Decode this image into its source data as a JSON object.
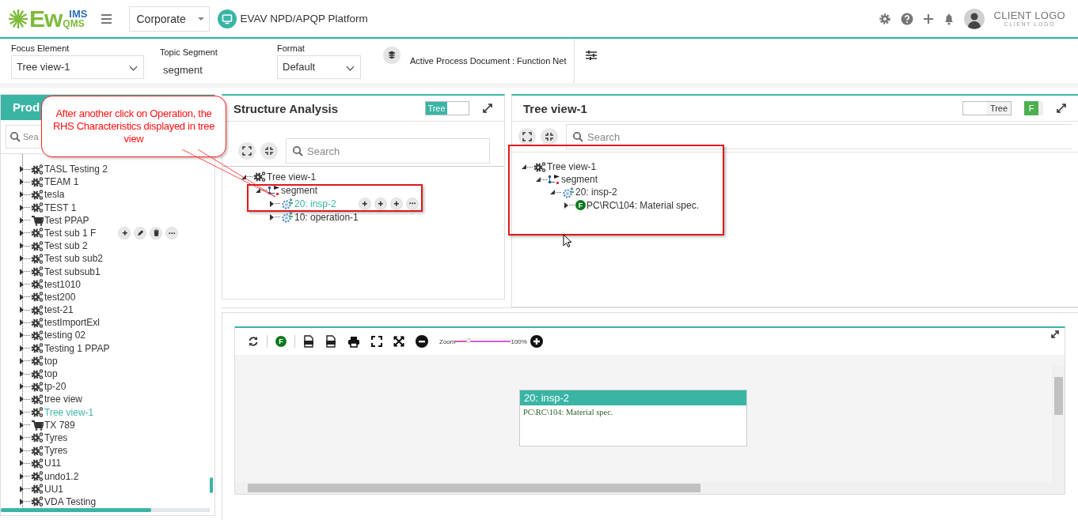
{
  "header": {
    "logo": {
      "main": "Ew",
      "top": "IMS",
      "bottom": "QMS"
    },
    "company": "Corporate",
    "platform": "EVAV NPD/APQP Platform",
    "client_logo": "CLIENT LOGO",
    "client_logo_sub": "CLIENT LOGO"
  },
  "toolbar": {
    "fields": [
      {
        "label": "Focus Element",
        "value": "Tree view-1",
        "kind": "select"
      },
      {
        "label": "Topic Segment",
        "value": "segment",
        "kind": "text"
      },
      {
        "label": "Format",
        "value": "Default",
        "kind": "select"
      }
    ],
    "active_document": "Active Process Document : Function Net"
  },
  "sidebar": {
    "title": "Prod",
    "search_placeholder": "Sea",
    "items": [
      {
        "label": "TASL Testing 2",
        "kind": "gear",
        "selected": false,
        "hovered": false
      },
      {
        "label": "TEAM 1",
        "kind": "gear",
        "selected": false,
        "hovered": false
      },
      {
        "label": "tesla",
        "kind": "gear",
        "selected": false,
        "hovered": false
      },
      {
        "label": "TEST 1",
        "kind": "gear",
        "selected": false,
        "hovered": false
      },
      {
        "label": "Test PPAP",
        "kind": "cart",
        "selected": false,
        "hovered": false
      },
      {
        "label": "Test sub 1 F",
        "kind": "gear",
        "selected": false,
        "hovered": true
      },
      {
        "label": "Test sub 2",
        "kind": "gear",
        "selected": false,
        "hovered": false
      },
      {
        "label": "Test sub sub2",
        "kind": "gear",
        "selected": false,
        "hovered": false
      },
      {
        "label": "Test subsub1",
        "kind": "gear",
        "selected": false,
        "hovered": false
      },
      {
        "label": "test1010",
        "kind": "gear",
        "selected": false,
        "hovered": false
      },
      {
        "label": "test200",
        "kind": "gear",
        "selected": false,
        "hovered": false
      },
      {
        "label": "test-21",
        "kind": "gear",
        "selected": false,
        "hovered": false
      },
      {
        "label": "testImportExl",
        "kind": "gear",
        "selected": false,
        "hovered": false
      },
      {
        "label": "testing 02",
        "kind": "gear",
        "selected": false,
        "hovered": false
      },
      {
        "label": "Testing 1 PPAP",
        "kind": "gear",
        "selected": false,
        "hovered": false
      },
      {
        "label": "top",
        "kind": "gear",
        "selected": false,
        "hovered": false
      },
      {
        "label": "top",
        "kind": "gear",
        "selected": false,
        "hovered": false
      },
      {
        "label": "tp-20",
        "kind": "gear",
        "selected": false,
        "hovered": false
      },
      {
        "label": "tree view",
        "kind": "gear",
        "selected": false,
        "hovered": false
      },
      {
        "label": "Tree view-1",
        "kind": "gear",
        "selected": true,
        "hovered": false
      },
      {
        "label": "TX 789",
        "kind": "cart",
        "selected": false,
        "hovered": false
      },
      {
        "label": "Tyres",
        "kind": "gear",
        "selected": false,
        "hovered": false
      },
      {
        "label": "Tyres",
        "kind": "gear",
        "selected": false,
        "hovered": false
      },
      {
        "label": "U11",
        "kind": "gear",
        "selected": false,
        "hovered": false
      },
      {
        "label": "undo1.2",
        "kind": "gear",
        "selected": false,
        "hovered": false
      },
      {
        "label": "UU1",
        "kind": "gear",
        "selected": false,
        "hovered": false
      },
      {
        "label": "VDA Testing",
        "kind": "gear",
        "selected": false,
        "hovered": false
      }
    ]
  },
  "structure_panel": {
    "title": "Structure Analysis",
    "toggle": {
      "label": "Tree",
      "on": true
    },
    "search_placeholder": "Search",
    "tree": [
      {
        "label": "Tree view-1",
        "kind": "gear",
        "expanded": true,
        "selected": false,
        "hovered": false,
        "children": [
          {
            "label": "segment",
            "kind": "segment",
            "expanded": true,
            "selected": false,
            "hovered": false,
            "children": [
              {
                "label": "20: insp-2",
                "kind": "operation",
                "expanded": false,
                "selected": true,
                "hovered": true
              },
              {
                "label": "10: operation-1",
                "kind": "operation",
                "expanded": false,
                "selected": false,
                "hovered": false
              }
            ]
          }
        ]
      }
    ]
  },
  "tree_panel": {
    "title": "Tree view-1",
    "toggle": {
      "label": "Tree",
      "on": false
    },
    "filter_badge": "F",
    "search_placeholder": "Search",
    "tree": [
      {
        "label": "Tree view-1",
        "kind": "gear",
        "expanded": true,
        "selected": false,
        "hovered": false,
        "children": [
          {
            "label": "segment",
            "kind": "segment",
            "expanded": true,
            "selected": false,
            "hovered": false,
            "children": [
              {
                "label": "20: insp-2",
                "kind": "operation",
                "expanded": true,
                "selected": false,
                "hovered": false,
                "children": [
                  {
                    "label": "PC\\RC\\104: Material spec.",
                    "kind": "characteristic",
                    "badge": "F",
                    "expanded": false,
                    "selected": false,
                    "hovered": false
                  }
                ]
              }
            ]
          }
        ]
      }
    ]
  },
  "diagram": {
    "filter_badge": "F",
    "zoom_label": "Zoom",
    "zoom": {
      "level": 0.23
    },
    "zoom_reading": "100%",
    "node": {
      "title": "20: insp-2",
      "body": "PC\\RC\\104: Material spec."
    }
  },
  "annotation": {
    "text": "After another click on Operation, the RHS Characteristics displayed in tree view"
  }
}
